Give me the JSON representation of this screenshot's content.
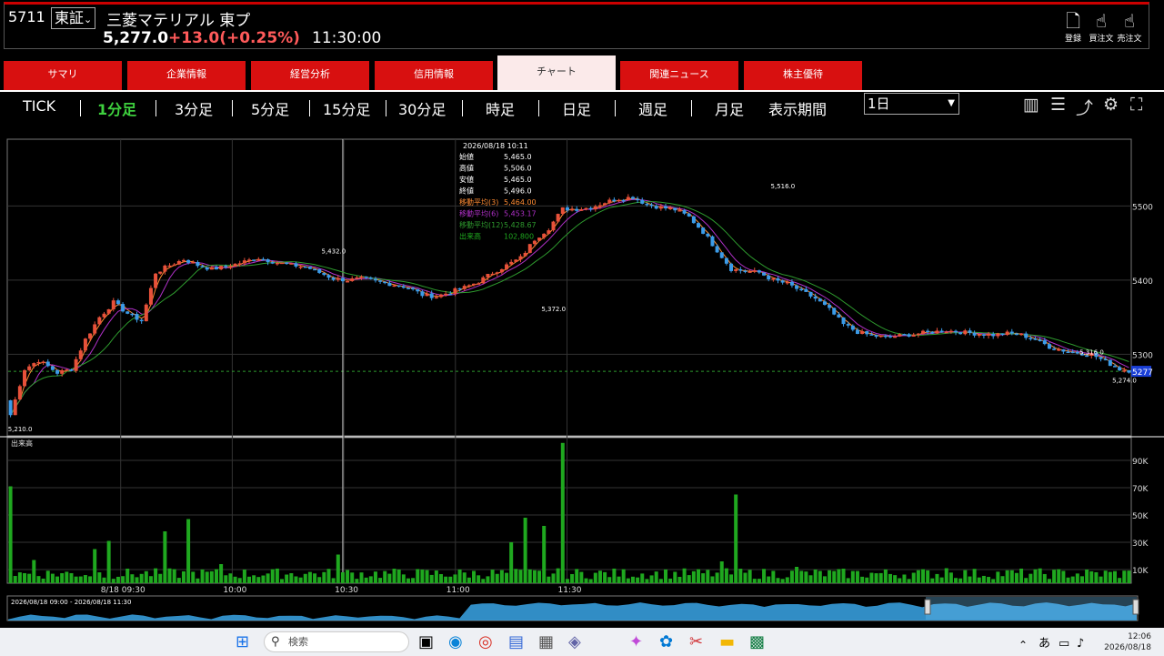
{
  "header": {
    "code": "5711",
    "exchange": "東証",
    "exchange_arrow": "⌄",
    "name": "三菱マテリアル 東プ",
    "price": "5,277.0",
    "change": "+13.0(+0.25%)",
    "time": "11:30:00",
    "buttons": [
      {
        "label": "登録",
        "icon": "plus-doc-icon"
      },
      {
        "label": "買注文",
        "icon": "buy-hand-icon"
      },
      {
        "label": "売注文",
        "icon": "sell-hand-icon"
      }
    ]
  },
  "tabs": [
    "サマリ",
    "企業情報",
    "経営分析",
    "信用情報",
    "チャート",
    "関連ニュース",
    "株主優待"
  ],
  "active_tab": "チャート",
  "periods": [
    "TICK",
    "1分足",
    "3分足",
    "5分足",
    "15分足",
    "30分足",
    "時足",
    "日足",
    "週足",
    "月足",
    "表示期間"
  ],
  "selected_period": "1分足",
  "range_select": "1日",
  "toolbar_icons": [
    "bar-chart-icon",
    "list-icon",
    "trend-icon",
    "gear-icon",
    "fullscreen-icon"
  ],
  "colors": {
    "up": "#e8513a",
    "down": "#3b9be8",
    "ma3": "#ff8c33",
    "ma6": "#b030c8",
    "ma12": "#2e9a2e",
    "volume": "#1fa81f",
    "change": "#ff5a5a"
  },
  "chart_data": {
    "type": "candlestick",
    "y_ticks": [
      5300,
      5400,
      5500
    ],
    "ylim": [
      5190,
      5590
    ],
    "x_ticks": [
      "8/18 09:30",
      "10:00",
      "10:30",
      "11:00",
      "11:30"
    ],
    "annotations": [
      "5,432.0",
      "5,372.0",
      "5,516.0",
      "5,316.0",
      "5,274.0",
      "5,210.0"
    ],
    "last_price_label": "5277",
    "tooltip": {
      "time": "2026/08/18 10:11",
      "rows": [
        {
          "k": "始値",
          "v": "5,465.0"
        },
        {
          "k": "高値",
          "v": "5,506.0"
        },
        {
          "k": "安値",
          "v": "5,465.0"
        },
        {
          "k": "終値",
          "v": "5,496.0"
        },
        {
          "k": "移動平均(3)",
          "v": "5,464.00"
        },
        {
          "k": "移動平均(6)",
          "v": "5,453.17"
        },
        {
          "k": "移動平均(12)",
          "v": "5,428.67"
        },
        {
          "k": "出来高",
          "v": "102,800"
        }
      ]
    },
    "volume_label": "出来高",
    "volume_ticks": [
      "10K",
      "30K",
      "50K",
      "70K",
      "90K"
    ],
    "volume_ylim": [
      0,
      100000
    ],
    "path": [
      [
        0,
        5218
      ],
      [
        3,
        5280
      ],
      [
        6,
        5292
      ],
      [
        10,
        5275
      ],
      [
        13,
        5280
      ],
      [
        16,
        5320
      ],
      [
        19,
        5350
      ],
      [
        22,
        5370
      ],
      [
        25,
        5355
      ],
      [
        28,
        5345
      ],
      [
        31,
        5410
      ],
      [
        34,
        5420
      ],
      [
        37,
        5428
      ],
      [
        40,
        5420
      ],
      [
        43,
        5415
      ],
      [
        46,
        5418
      ],
      [
        50,
        5425
      ],
      [
        53,
        5430
      ],
      [
        56,
        5425
      ],
      [
        60,
        5420
      ],
      [
        63,
        5418
      ],
      [
        66,
        5410
      ],
      [
        69,
        5402
      ],
      [
        72,
        5400
      ],
      [
        75,
        5402
      ],
      [
        78,
        5398
      ],
      [
        82,
        5394
      ],
      [
        85,
        5390
      ],
      [
        88,
        5380
      ],
      [
        91,
        5378
      ],
      [
        94,
        5384
      ],
      [
        97,
        5390
      ],
      [
        100,
        5398
      ],
      [
        103,
        5410
      ],
      [
        106,
        5420
      ],
      [
        109,
        5430
      ],
      [
        112,
        5455
      ],
      [
        115,
        5470
      ],
      [
        118,
        5496
      ],
      [
        121,
        5496
      ],
      [
        124,
        5498
      ],
      [
        127,
        5505
      ],
      [
        130,
        5510
      ],
      [
        133,
        5512
      ],
      [
        136,
        5502
      ],
      [
        139,
        5498
      ],
      [
        142,
        5495
      ],
      [
        145,
        5485
      ],
      [
        148,
        5465
      ],
      [
        151,
        5440
      ],
      [
        154,
        5415
      ],
      [
        157,
        5412
      ],
      [
        160,
        5410
      ],
      [
        163,
        5400
      ],
      [
        166,
        5395
      ],
      [
        169,
        5385
      ],
      [
        172,
        5375
      ],
      [
        175,
        5360
      ],
      [
        178,
        5340
      ],
      [
        181,
        5330
      ],
      [
        184,
        5325
      ],
      [
        187,
        5323
      ],
      [
        190,
        5325
      ],
      [
        194,
        5328
      ],
      [
        197,
        5330
      ],
      [
        200,
        5332
      ],
      [
        203,
        5330
      ],
      [
        206,
        5328
      ],
      [
        210,
        5326
      ],
      [
        213,
        5328
      ],
      [
        216,
        5326
      ],
      [
        219,
        5320
      ],
      [
        222,
        5310
      ],
      [
        225,
        5305
      ],
      [
        228,
        5302
      ],
      [
        231,
        5300
      ],
      [
        234,
        5290
      ],
      [
        237,
        5280
      ],
      [
        240,
        5277
      ]
    ],
    "volume_series": [
      {
        "t": 0,
        "v": 71000
      },
      {
        "t": 5,
        "v": 17000
      },
      {
        "t": 18,
        "v": 25000
      },
      {
        "t": 21,
        "v": 31000
      },
      {
        "t": 33,
        "v": 38000
      },
      {
        "t": 38,
        "v": 47000
      },
      {
        "t": 45,
        "v": 14000
      },
      {
        "t": 70,
        "v": 21000
      },
      {
        "t": 107,
        "v": 30000
      },
      {
        "t": 110,
        "v": 48000
      },
      {
        "t": 114,
        "v": 42000
      },
      {
        "t": 118,
        "v": 102800
      },
      {
        "t": 152,
        "v": 16000
      },
      {
        "t": 155,
        "v": 65000
      },
      {
        "t": 168,
        "v": 12000
      },
      {
        "t": 200,
        "v": 11000
      }
    ],
    "navigator_label": "2026/08/18 09:00 - 2026/08/18 11:30"
  },
  "taskbar": {
    "search_placeholder": "検索",
    "ime": "あ",
    "clock_time": "12:06",
    "clock_date": "2026/08/18"
  }
}
